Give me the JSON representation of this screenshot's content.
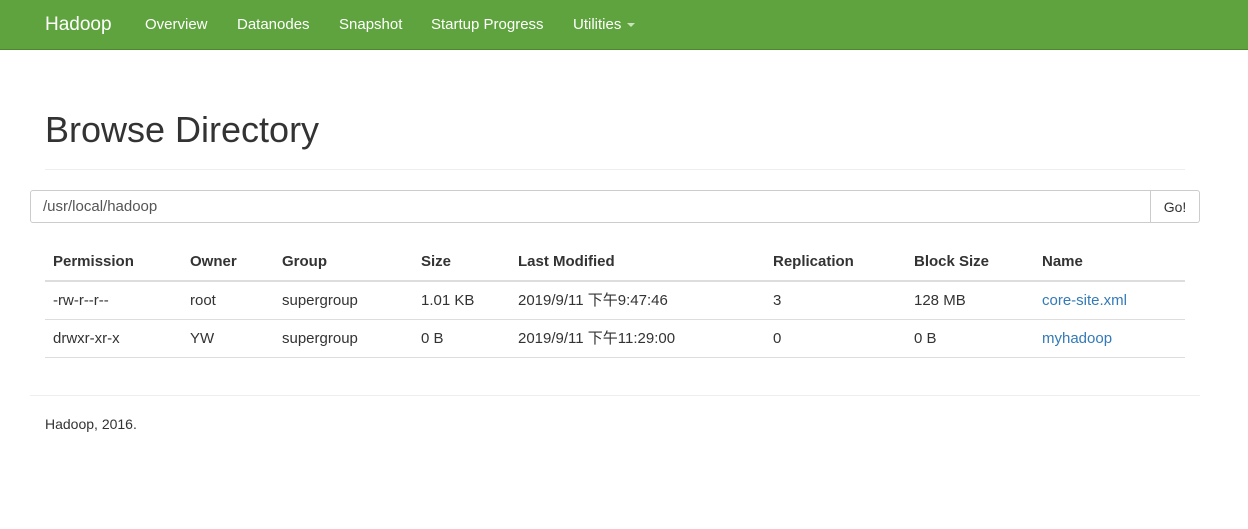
{
  "navbar": {
    "brand": "Hadoop",
    "items": [
      {
        "label": "Overview"
      },
      {
        "label": "Datanodes"
      },
      {
        "label": "Snapshot"
      },
      {
        "label": "Startup Progress"
      },
      {
        "label": "Utilities"
      }
    ],
    "color": "#5fa33e"
  },
  "page": {
    "title": "Browse Directory"
  },
  "path_bar": {
    "value": "/usr/local/hadoop",
    "go_label": "Go!"
  },
  "table": {
    "columns": [
      "Permission",
      "Owner",
      "Group",
      "Size",
      "Last Modified",
      "Replication",
      "Block Size",
      "Name"
    ],
    "rows": [
      [
        "-rw-r--r--",
        "root",
        "supergroup",
        "1.01 KB",
        "2019/9/11 下午9:47:46",
        "3",
        "128 MB",
        "core-site.xml"
      ],
      [
        "drwxr-xr-x",
        "YW",
        "supergroup",
        "0 B",
        "2019/9/11 下午11:29:00",
        "0",
        "0 B",
        "myhadoop"
      ]
    ],
    "link_color": "#337ab7"
  },
  "footer": {
    "text": "Hadoop, 2016."
  }
}
